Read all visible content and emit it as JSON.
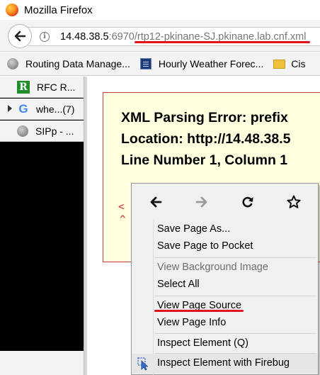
{
  "window": {
    "title": "Mozilla Firefox"
  },
  "url": {
    "host": "14.48.38.5",
    "rest": ":6970/rtp12-pkinane-SJ.pkinane.lab.cnf.xml"
  },
  "bookmarks": [
    {
      "label": "Routing Data Manage...",
      "icon": "globe-icon"
    },
    {
      "label": "Hourly Weather Forec...",
      "icon": "weather-channel-icon"
    },
    {
      "label": "Cis",
      "icon": "folder-icon"
    }
  ],
  "tabs": [
    {
      "label": "RFC R...",
      "icon": "rfc-icon"
    },
    {
      "label": "whe...(7)",
      "icon": "google-icon"
    },
    {
      "label": "SIPp - ...",
      "icon": "globe-icon"
    }
  ],
  "error": {
    "line1": "XML Parsing Error: prefix",
    "line2": "Location: http://14.48.38.5",
    "line3": "Line Number 1, Column 1",
    "source_fragment": "<",
    "caret": "^"
  },
  "context_menu": {
    "items": [
      {
        "label": "Save Page As...",
        "disabled": false
      },
      {
        "label": "Save Page to Pocket",
        "disabled": false
      },
      {
        "label": "View Background Image",
        "disabled": true
      },
      {
        "label": "Select All",
        "disabled": false
      },
      {
        "label": "View Page Source",
        "disabled": false
      },
      {
        "label": "View Page Info",
        "disabled": false
      },
      {
        "label": "Inspect Element (Q)",
        "disabled": false
      },
      {
        "label": "Inspect Element with Firebug",
        "disabled": false
      }
    ]
  },
  "colors": {
    "highlight_underline": "#e0141e",
    "error_box_bg": "#ffffe0",
    "error_text_red": "#cc2222"
  }
}
